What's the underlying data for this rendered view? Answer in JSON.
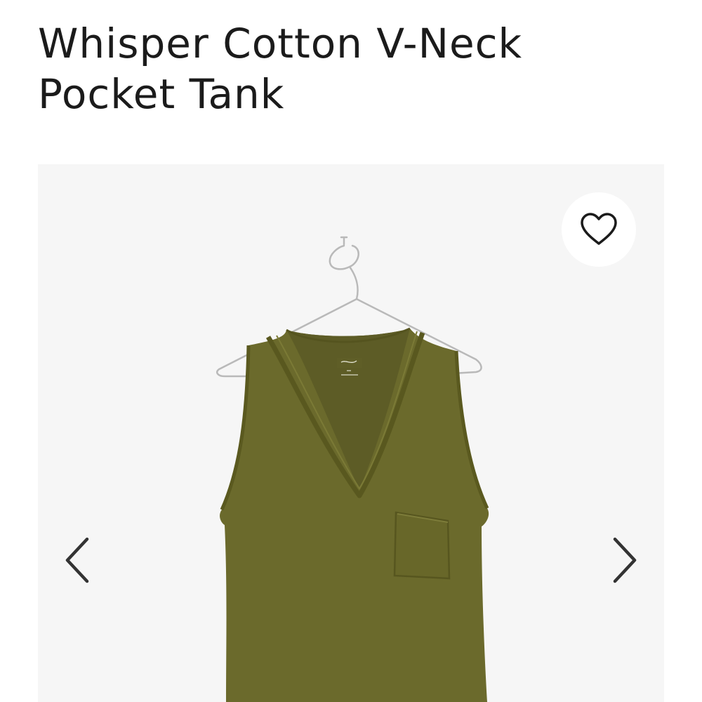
{
  "product": {
    "title_line1": "Whisper Cotton V-Neck",
    "title_line2": "Pocket Tank",
    "color_hex": "#6b6a2c"
  },
  "gallery": {
    "favorite_icon": "heart-outline-icon",
    "prev_icon": "chevron-left-icon",
    "next_icon": "chevron-right-icon"
  }
}
